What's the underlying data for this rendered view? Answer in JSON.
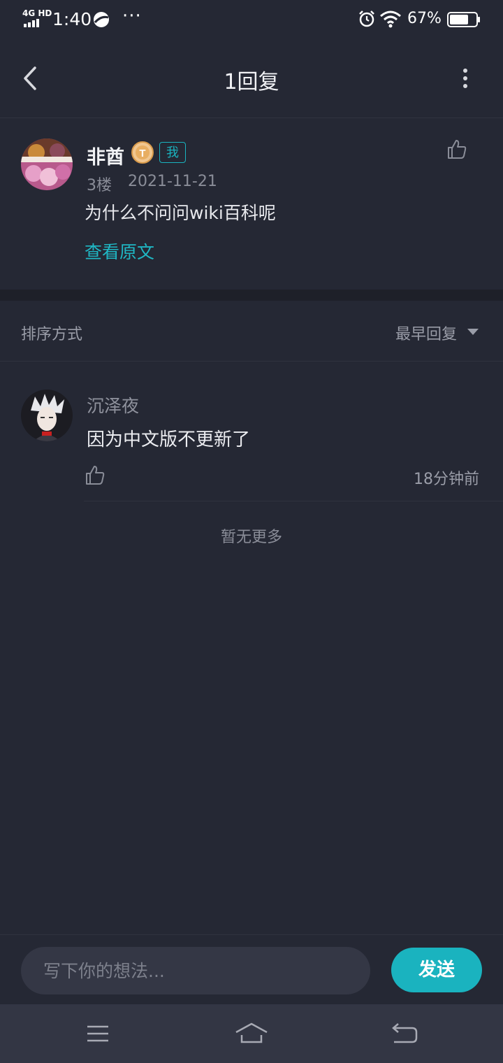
{
  "status_bar": {
    "network": "4G HD",
    "time": "1:40",
    "more": "···",
    "battery": "67%"
  },
  "header": {
    "title": "1回复"
  },
  "original_comment": {
    "username": "非酋",
    "me_tag": "我",
    "floor": "3楼",
    "date": "2021-11-21",
    "text": "为什么不问问wiki百科呢",
    "view_original": "查看原文"
  },
  "sort": {
    "label": "排序方式",
    "value": "最早回复"
  },
  "replies": [
    {
      "username": "沉泽夜",
      "text": "因为中文版不更新了",
      "time": "18分钟前"
    }
  ],
  "no_more": "暂无更多",
  "input": {
    "placeholder": "写下你的想法...",
    "send_label": "发送"
  },
  "colors": {
    "background": "#252834",
    "accent": "#1ab3bf",
    "navbar": "#333644"
  }
}
